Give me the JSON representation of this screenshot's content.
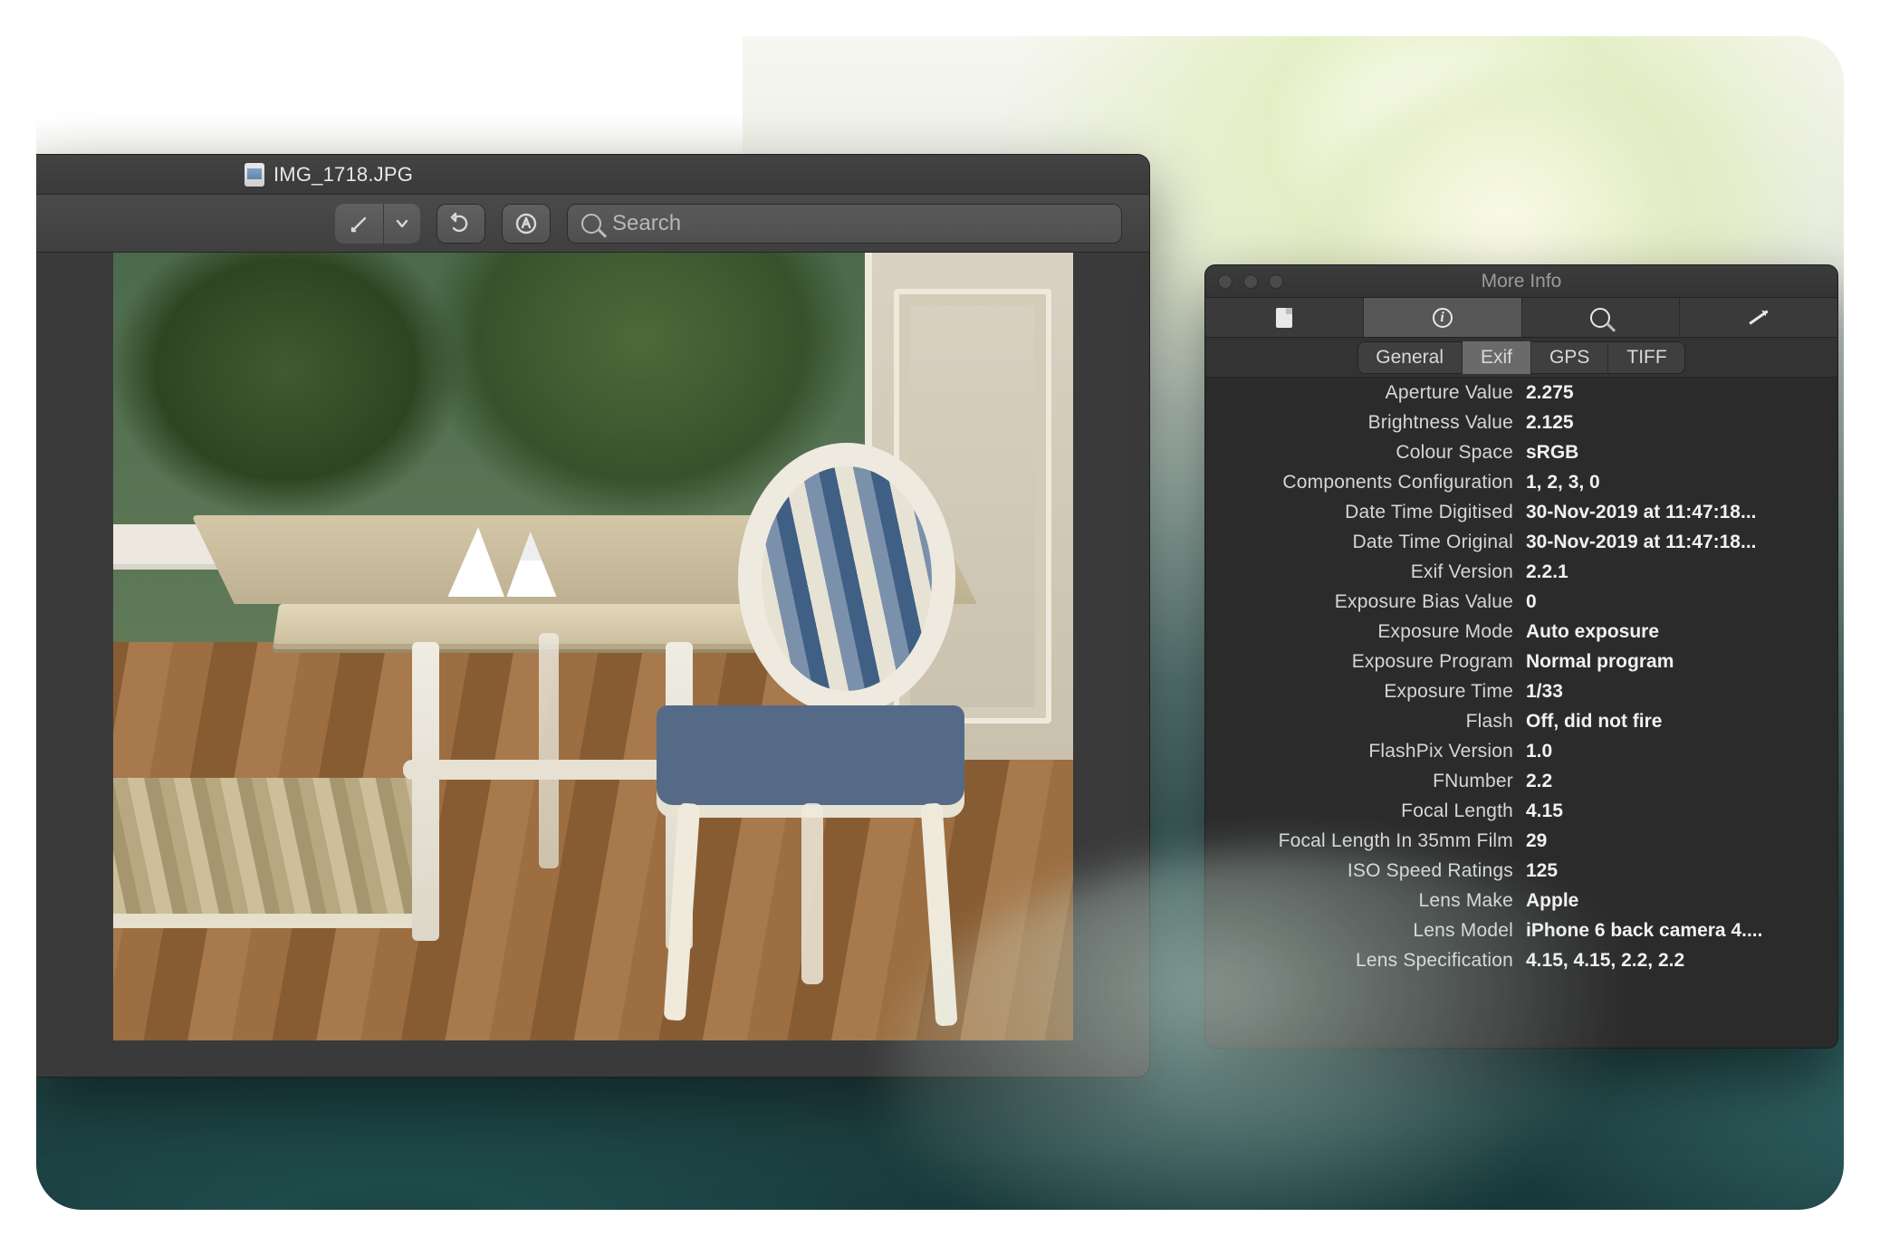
{
  "preview": {
    "title": "IMG_1718.JPG",
    "search_placeholder": "Search"
  },
  "inspector": {
    "title": "More Info",
    "tabs": [
      "General",
      "Exif",
      "GPS",
      "TIFF"
    ],
    "active_tab": "Exif",
    "rows": [
      {
        "k": "Aperture Value",
        "v": "2.275"
      },
      {
        "k": "Brightness Value",
        "v": "2.125"
      },
      {
        "k": "Colour Space",
        "v": "sRGB"
      },
      {
        "k": "Components Configuration",
        "v": "1, 2, 3, 0"
      },
      {
        "k": "Date Time Digitised",
        "v": "30-Nov-2019 at 11:47:18..."
      },
      {
        "k": "Date Time Original",
        "v": "30-Nov-2019 at 11:47:18..."
      },
      {
        "k": "Exif Version",
        "v": "2.2.1"
      },
      {
        "k": "Exposure Bias Value",
        "v": "0"
      },
      {
        "k": "Exposure Mode",
        "v": "Auto exposure"
      },
      {
        "k": "Exposure Program",
        "v": "Normal program"
      },
      {
        "k": "Exposure Time",
        "v": "1/33"
      },
      {
        "k": "Flash",
        "v": "Off, did not fire"
      },
      {
        "k": "FlashPix Version",
        "v": "1.0"
      },
      {
        "k": "FNumber",
        "v": "2.2"
      },
      {
        "k": "Focal Length",
        "v": "4.15"
      },
      {
        "k": "Focal Length In 35mm Film",
        "v": "29"
      },
      {
        "k": "ISO Speed Ratings",
        "v": "125"
      },
      {
        "k": "Lens Make",
        "v": "Apple"
      },
      {
        "k": "Lens Model",
        "v": "iPhone 6 back camera 4...."
      },
      {
        "k": "Lens Specification",
        "v": "4.15, 4.15, 2.2, 2.2"
      }
    ]
  }
}
